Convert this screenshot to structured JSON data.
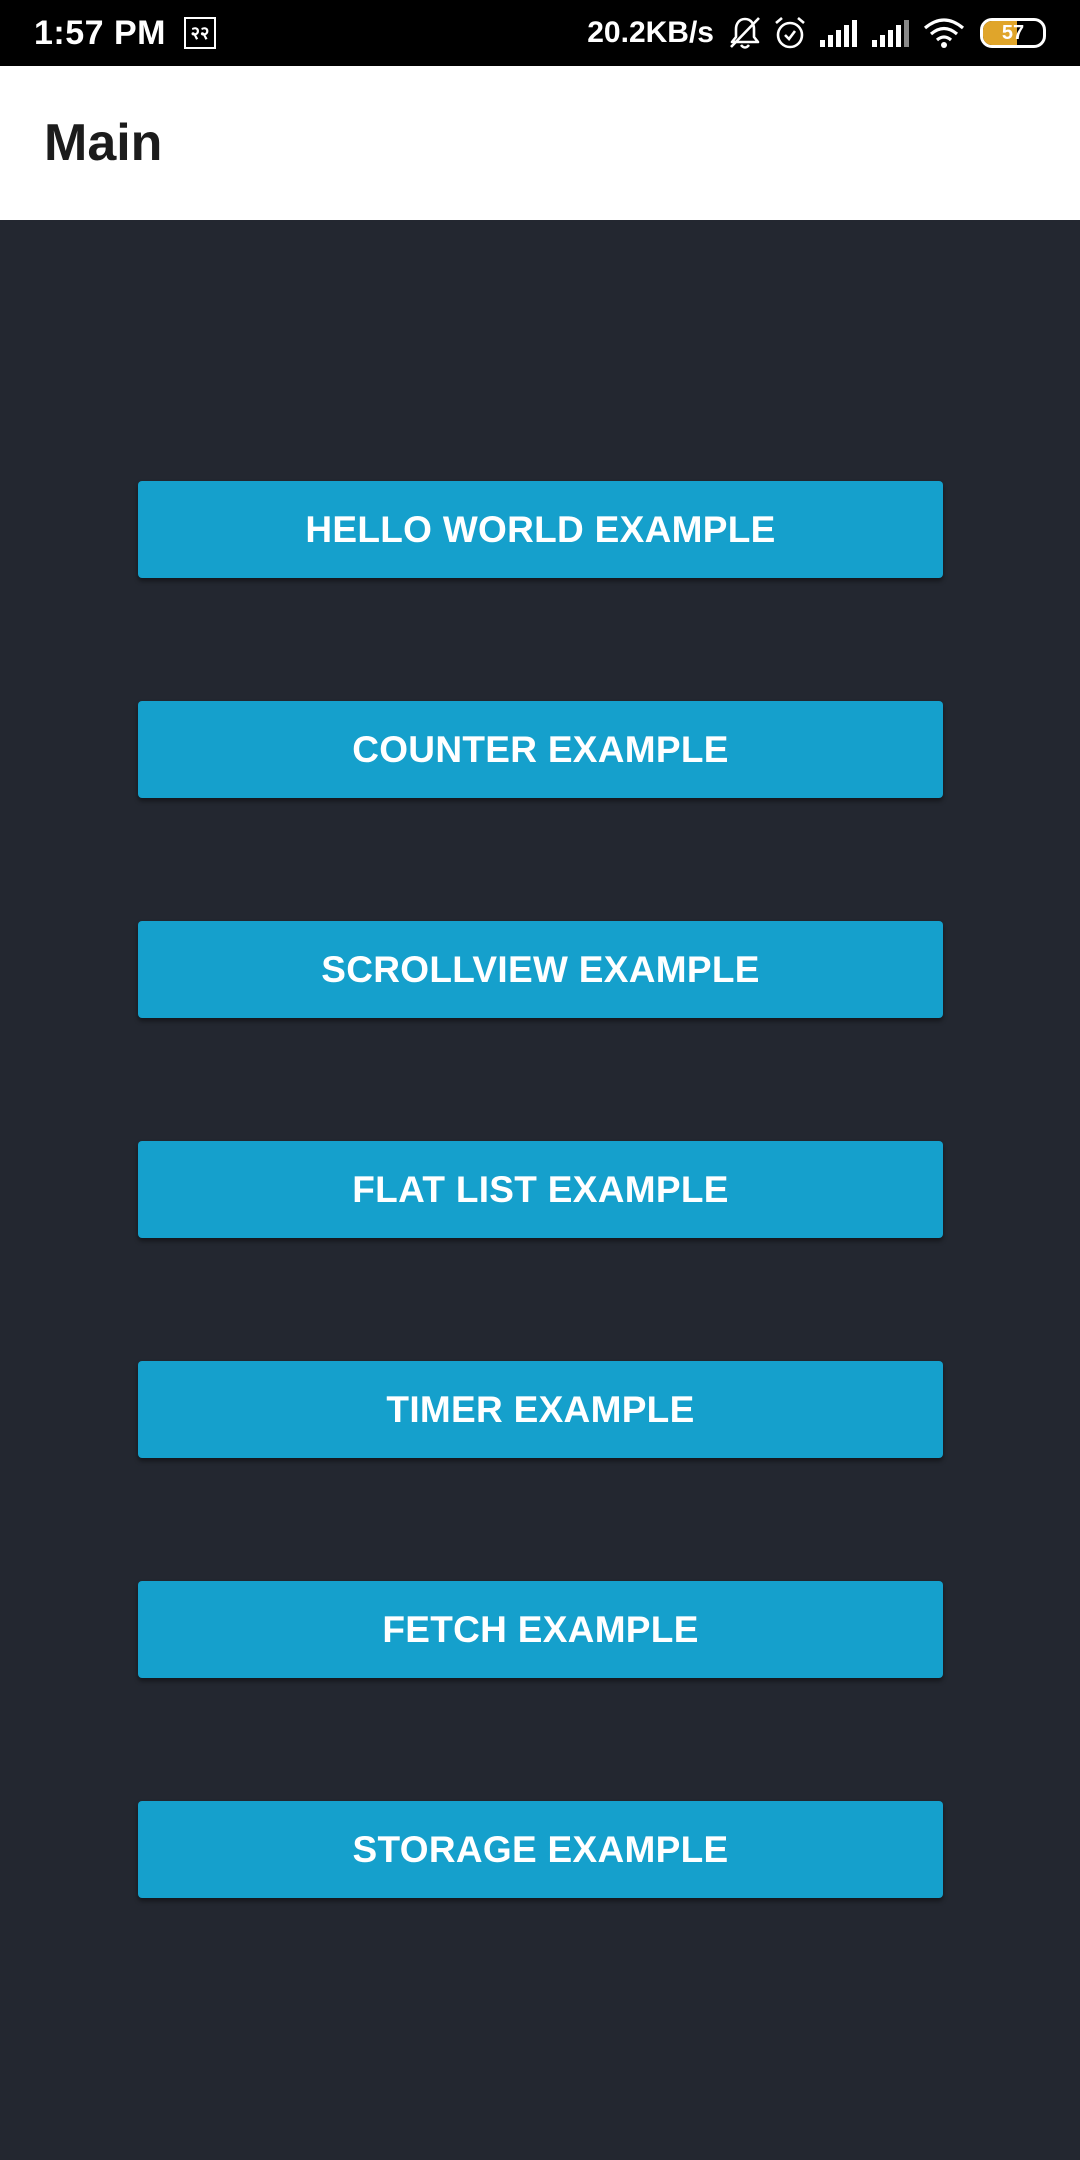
{
  "status_bar": {
    "time": "1:57 PM",
    "sim_badge": "२२",
    "net_speed": "20.2KB/s",
    "battery_level": "57",
    "battery_fraction": 0.57,
    "icons": [
      "notifications-off-icon",
      "alarm-icon",
      "signal-icon",
      "signal-icon",
      "wifi-icon",
      "battery-icon"
    ]
  },
  "app_bar": {
    "title": "Main"
  },
  "buttons": [
    {
      "label": "HELLO WORLD EXAMPLE"
    },
    {
      "label": "COUNTER EXAMPLE"
    },
    {
      "label": "SCROLLVIEW EXAMPLE"
    },
    {
      "label": "FLAT LIST EXAMPLE"
    },
    {
      "label": "TIMER EXAMPLE"
    },
    {
      "label": "FETCH EXAMPLE"
    },
    {
      "label": "STORAGE EXAMPLE"
    }
  ],
  "colors": {
    "background": "#232730",
    "button": "#15a0cc",
    "app_bar": "#ffffff",
    "status_bar": "#000000",
    "battery_fill": "#e0a52a"
  }
}
